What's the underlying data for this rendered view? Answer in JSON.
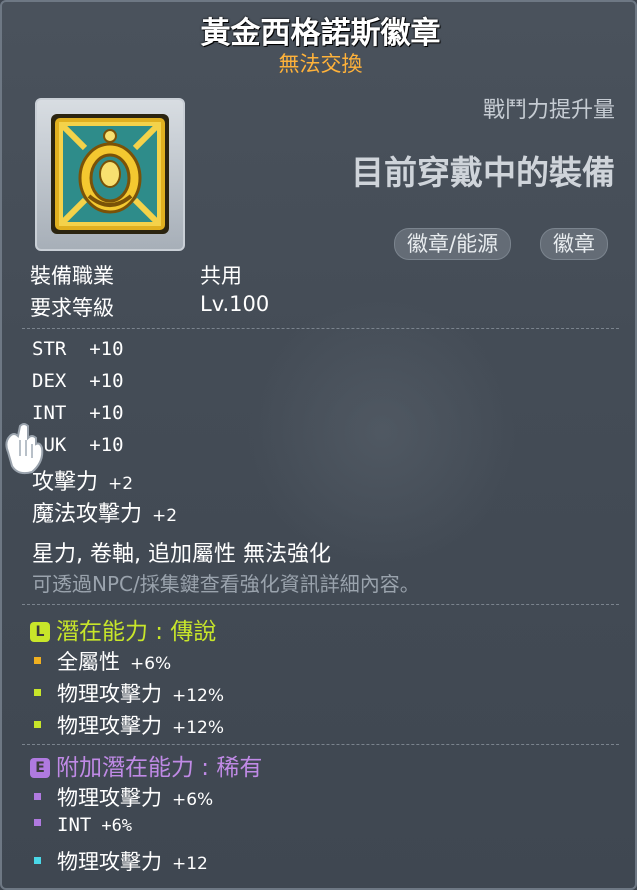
{
  "item": {
    "name": "黃金西格諾斯徽章",
    "trade_status": "無法交換"
  },
  "power_label": "戰鬥力提升量",
  "equipped_label": "目前穿戴中的裝備",
  "tags": [
    "徽章/能源",
    "徽章"
  ],
  "requirements": [
    {
      "label": "裝備職業",
      "value": "共用"
    },
    {
      "label": "要求等級",
      "value": "Lv.100"
    }
  ],
  "stats": [
    {
      "name": "STR",
      "value": "+10"
    },
    {
      "name": "DEX",
      "value": "+10"
    },
    {
      "name": "INT",
      "value": "+10"
    },
    {
      "name": "LUK",
      "value": "+10"
    },
    {
      "name": "攻擊力",
      "value": "+2"
    },
    {
      "name": "魔法攻擊力",
      "value": "+2"
    }
  ],
  "restrictions": "星力, 卷軸, 追加屬性 無法強化",
  "hint": "可透過NPC/採集鍵查看強化資訊詳細內容。",
  "potential": {
    "badge": "L",
    "title": "潛在能力 : 傳說",
    "color": "#c8e62a",
    "lines": [
      {
        "name": "全屬性",
        "value": "+6%",
        "dot": "#f0b020"
      },
      {
        "name": "物理攻擊力",
        "value": "+12%",
        "dot": "#c8e62a"
      },
      {
        "name": "物理攻擊力",
        "value": "+12%",
        "dot": "#c8e62a"
      }
    ]
  },
  "additional_potential": {
    "badge": "E",
    "title": "附加潛在能力 : 稀有",
    "color": "#c08ae6",
    "lines": [
      {
        "name": "物理攻擊力",
        "value": "+6%",
        "dot": "#b07ae0"
      },
      {
        "name": "INT",
        "value": "+6%",
        "dot": "#b07ae0"
      },
      {
        "name": "物理攻擊力",
        "value": "+12",
        "dot": "#4ad8e8"
      }
    ]
  }
}
